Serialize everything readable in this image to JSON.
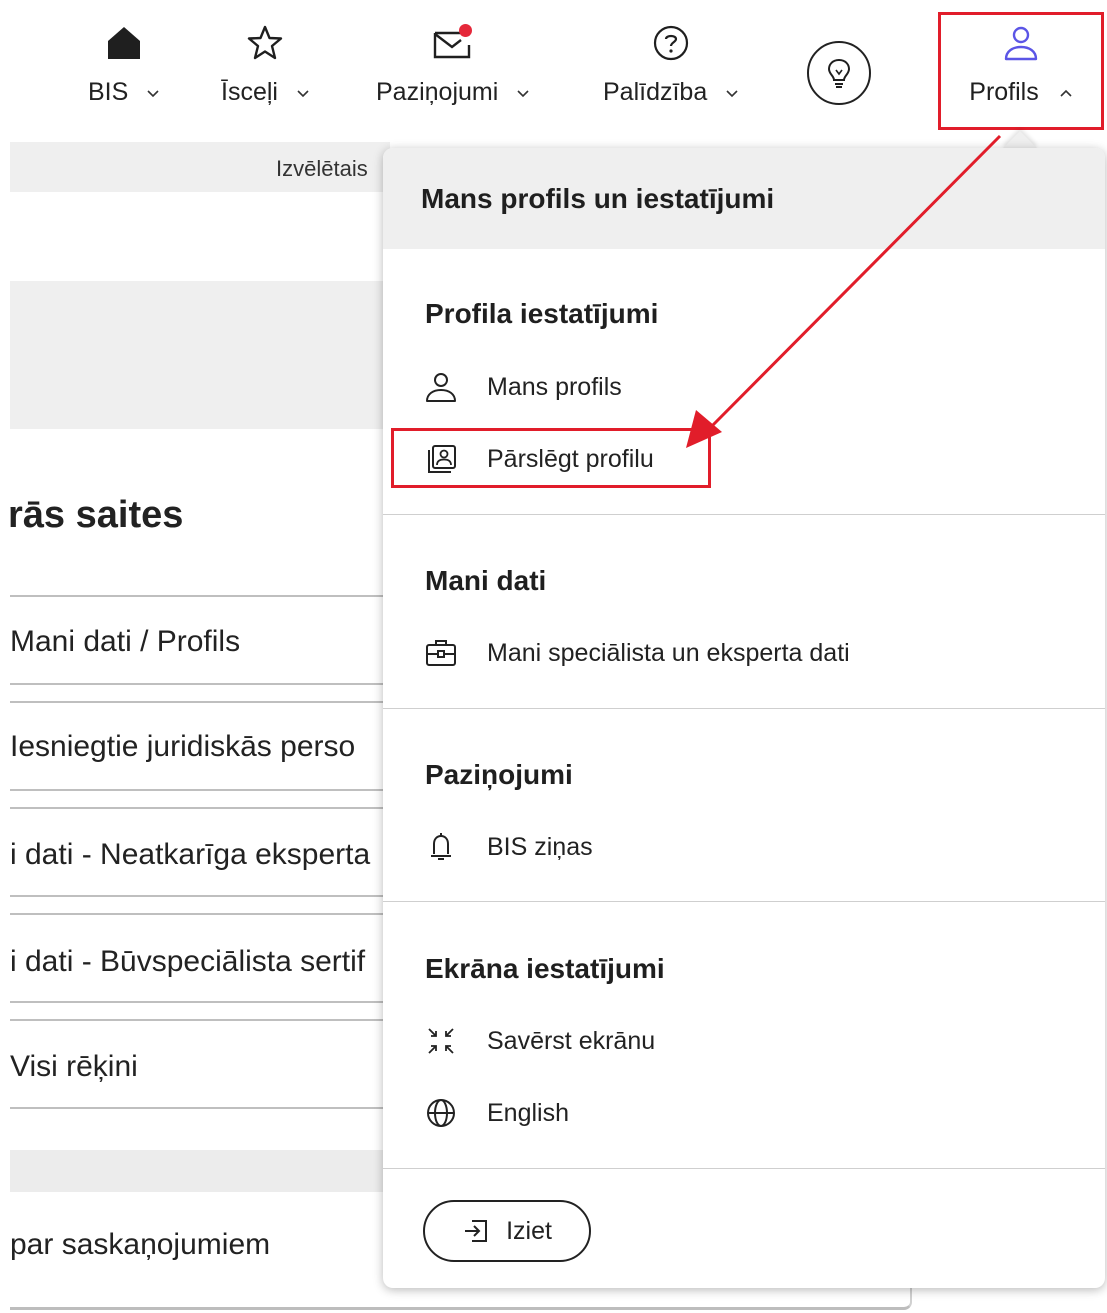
{
  "nav": {
    "items": [
      {
        "label": "BIS",
        "icon": "home-icon"
      },
      {
        "label": "Īsceļi",
        "icon": "star-icon"
      },
      {
        "label": "Paziņojumi",
        "icon": "envelope-icon"
      },
      {
        "label": "Palīdzība",
        "icon": "help-icon"
      }
    ],
    "tips_icon": "lightbulb-icon",
    "profile": {
      "label": "Profils",
      "icon": "user-icon",
      "accent": "#5b55e6"
    },
    "notification_dot_color": "#e5283a"
  },
  "page": {
    "sub_strip_text": "Izvēlētais",
    "links_title": "rās saites",
    "links": [
      "Mani dati / Profils",
      "Iesniegtie juridiskās perso",
      "i dati - Neatkarīga eksperta",
      "i dati - Būvspeciālista sertif",
      "Visi rēķini"
    ],
    "bottom_link": "par saskaņojumiem"
  },
  "dropdown": {
    "title": "Mans profils un iestatījumi",
    "sections": [
      {
        "title": "Profila iestatījumi",
        "items": [
          {
            "label": "Mans profils",
            "icon": "user-icon"
          },
          {
            "label": "Pārslēgt profilu",
            "icon": "switch-profile-icon"
          }
        ]
      },
      {
        "title": "Mani dati",
        "items": [
          {
            "label": "Mani speciālista un eksperta dati",
            "icon": "briefcase-icon"
          }
        ]
      },
      {
        "title": "Paziņojumi",
        "items": [
          {
            "label": "BIS ziņas",
            "icon": "bell-icon"
          }
        ]
      },
      {
        "title": "Ekrāna iestatījumi",
        "items": [
          {
            "label": "Savērst ekrānu",
            "icon": "collapse-icon"
          },
          {
            "label": "English",
            "icon": "globe-icon"
          }
        ]
      }
    ],
    "logout_label": "Iziet",
    "logout_icon": "logout-icon"
  },
  "annotation": {
    "color": "#e11d2a"
  }
}
